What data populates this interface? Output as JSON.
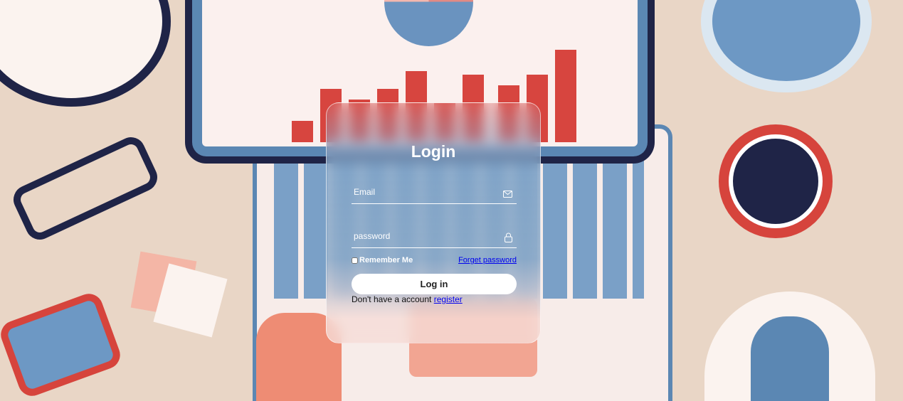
{
  "login": {
    "title": "Login",
    "email_placeholder": "Email",
    "password_placeholder": "password",
    "remember_label": "Remember Me",
    "forgot_link": "Forget password",
    "login_button": "Log in",
    "register_prompt": "Don't have a account",
    "register_link": "register"
  },
  "icons": {
    "email": "envelope-icon",
    "password": "lock-icon"
  }
}
